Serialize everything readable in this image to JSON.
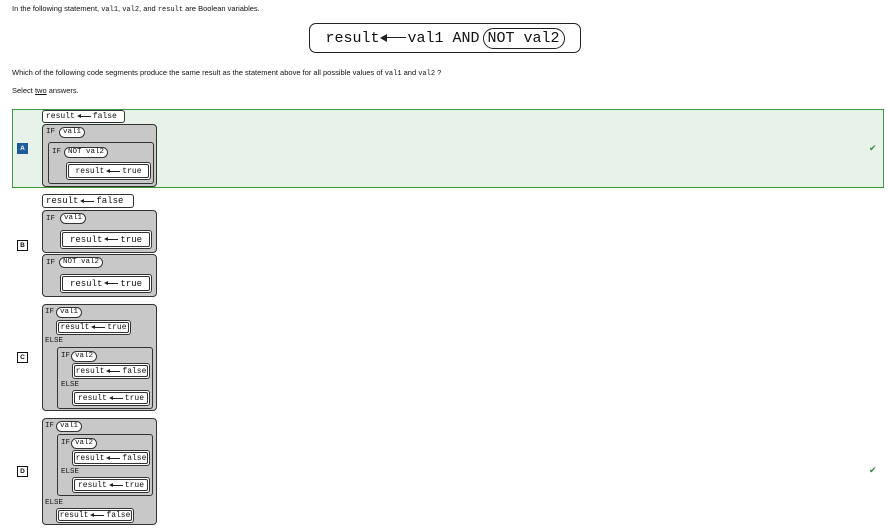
{
  "intro": {
    "before": "In the following statement,",
    "v1": "val1",
    "comma": ",",
    "v2": "val2",
    "and": ", and",
    "res": "result",
    "after": "are Boolean variables."
  },
  "statement": {
    "result": "result",
    "val1": "val1",
    "and_kw": "AND",
    "not_val2": "NOT val2"
  },
  "question": {
    "before": "Which of the following code segments produce the same result as the statement above for all possible values of",
    "v1": "val1",
    "and": "and",
    "v2": "val2",
    "after": "?"
  },
  "select": {
    "before": "Select",
    "emph": "two",
    "after": "answers."
  },
  "options": {
    "A": {
      "letter": "A",
      "selected": true,
      "correct": true
    },
    "B": {
      "letter": "B",
      "selected": false,
      "correct": false
    },
    "C": {
      "letter": "C",
      "selected": false,
      "correct": false
    },
    "D": {
      "letter": "D",
      "selected": false,
      "correct": true
    }
  },
  "code": {
    "result": "result",
    "false": "false",
    "true": "true",
    "if": "IF",
    "else": "ELSE",
    "val1": "val1",
    "val2": "val2",
    "not_val2": "NOT val2"
  },
  "check_mark": "✔",
  "colors": {
    "selected_bg": "#e7f3e8",
    "selected_border": "#3a9a44",
    "badge_selected": "#1d5b9a",
    "check": "#2d8b38",
    "block_grey": "#c8c8c8"
  }
}
